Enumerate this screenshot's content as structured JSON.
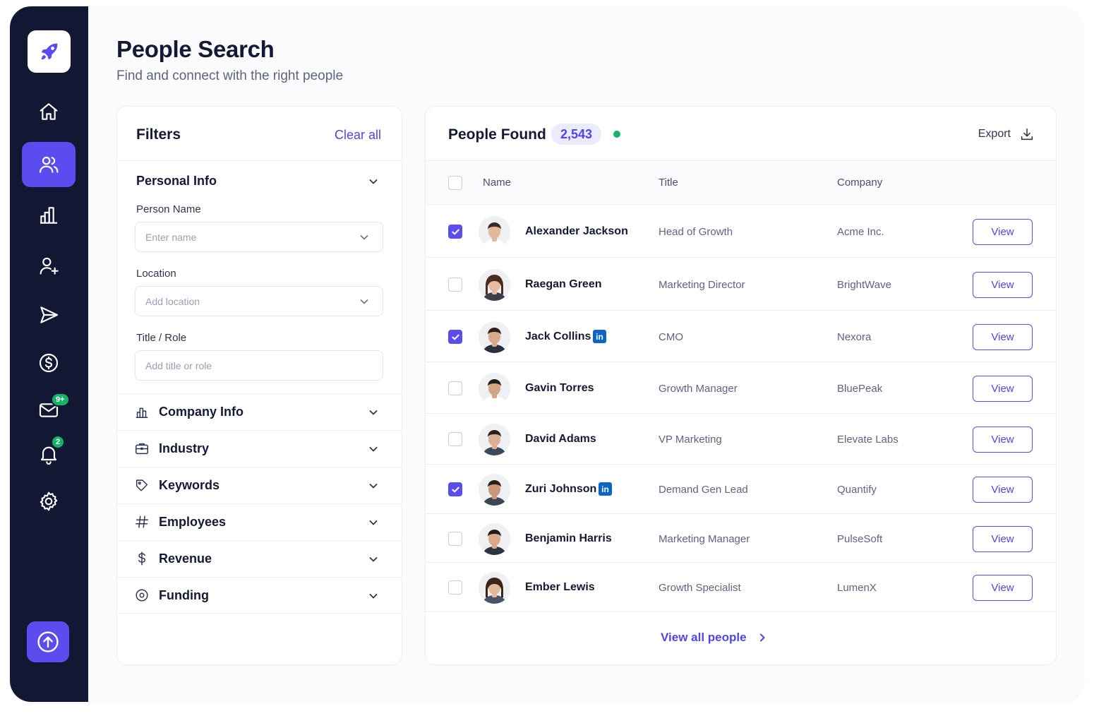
{
  "header": {
    "title": "People Search",
    "subtitle": "Find and connect with the right people"
  },
  "sidebar": {
    "badges": {
      "mail": "9+",
      "notifications": "2"
    },
    "accent_color": "#5b4cf0",
    "background_color": "#121834",
    "items": [
      {
        "icon": "home-icon"
      },
      {
        "icon": "users-icon",
        "active": true
      },
      {
        "icon": "bar-chart-icon"
      },
      {
        "icon": "user-plus-icon"
      },
      {
        "icon": "send-icon"
      },
      {
        "icon": "dollar-circle-icon"
      },
      {
        "icon": "mail-icon"
      },
      {
        "icon": "bell-icon"
      },
      {
        "icon": "gear-icon"
      }
    ]
  },
  "filters": {
    "title": "Filters",
    "clear_all": "Clear all",
    "personal_info": {
      "label": "Personal Info",
      "person_name_label": "Person Name",
      "person_name_placeholder": "Enter name",
      "location_label": "Location",
      "location_placeholder": "Add location",
      "title_role_label": "Title / Role",
      "title_role_placeholder": "Add title or role"
    },
    "sections": [
      {
        "label": "Company Info",
        "icon": "building-chart-icon"
      },
      {
        "label": "Industry",
        "icon": "briefcase-icon"
      },
      {
        "label": "Keywords",
        "icon": "tag-icon"
      },
      {
        "label": "Employees",
        "icon": "hash-icon"
      },
      {
        "label": "Revenue",
        "icon": "dollar-icon"
      },
      {
        "label": "Funding",
        "icon": "target-icon"
      }
    ]
  },
  "people": {
    "title": "People Found",
    "count": "2,543",
    "export_label": "Export",
    "columns": {
      "name": "Name",
      "title": "Title",
      "company": "Company"
    },
    "view_label": "View",
    "view_all": "View all people",
    "rows": [
      {
        "name": "Alexander Jackson",
        "title": "Head of Growth",
        "company": "Acme Inc.",
        "checked": true,
        "linkedin": false
      },
      {
        "name": "Raegan Green",
        "title": "Marketing Director",
        "company": "BrightWave",
        "checked": false,
        "linkedin": false
      },
      {
        "name": "Jack Collins",
        "title": "CMO",
        "company": "Nexora",
        "checked": true,
        "linkedin": true
      },
      {
        "name": "Gavin Torres",
        "title": "Growth Manager",
        "company": "BluePeak",
        "checked": false,
        "linkedin": false
      },
      {
        "name": "David Adams",
        "title": "VP Marketing",
        "company": "Elevate Labs",
        "checked": false,
        "linkedin": false
      },
      {
        "name": "Zuri Johnson",
        "title": "Demand Gen Lead",
        "company": "Quantify",
        "checked": true,
        "linkedin": true
      },
      {
        "name": "Benjamin Harris",
        "title": "Marketing Manager",
        "company": "PulseSoft",
        "checked": false,
        "linkedin": false
      },
      {
        "name": "Ember Lewis",
        "title": "Growth Specialist",
        "company": "LumenX",
        "checked": false,
        "linkedin": false
      }
    ],
    "linkedin_glyph": "in"
  }
}
